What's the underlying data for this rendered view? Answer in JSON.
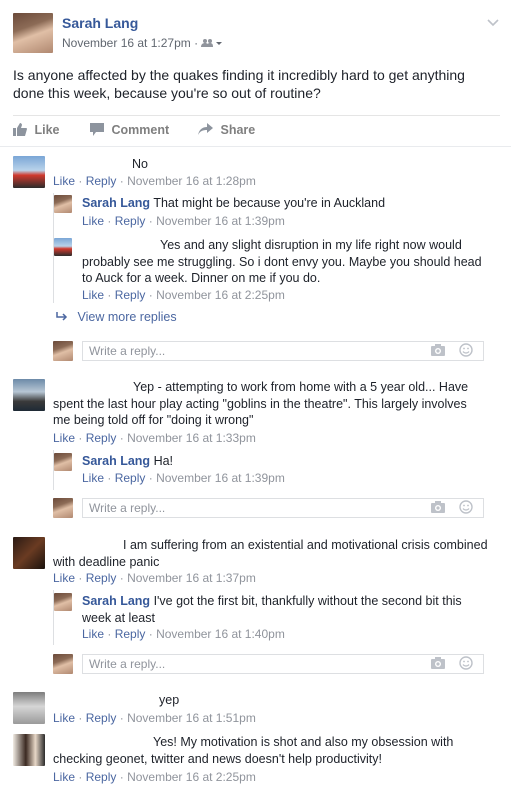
{
  "post": {
    "author": "Sarah Lang",
    "time": "November 16 at 1:27pm",
    "sep": "·",
    "text": "Is anyone affected by the quakes finding it incredibly hard to get anything done this week, because you're so out of routine?",
    "actions": {
      "like": "Like",
      "comment": "Comment",
      "share": "Share"
    }
  },
  "labels": {
    "like": "Like",
    "reply": "Reply",
    "dot": "·",
    "reply_placeholder": "Write a reply...",
    "view_more": "View more replies"
  },
  "comments": [
    {
      "text": "No",
      "time": "November 16 at 1:28pm"
    },
    {
      "text": "Yep - attempting to work from home with a 5 year old... Have spent the last hour play acting \"goblins in the theatre\". This largely involves me being told off for \"doing it wrong\"",
      "time": "November 16 at 1:33pm"
    },
    {
      "text": "I am suffering from an existential and motivational crisis combined with deadline panic",
      "time": "November 16 at 1:37pm"
    },
    {
      "text": "yep",
      "time": "November 16 at 1:51pm"
    },
    {
      "text": "Yes! My motivation is shot and also my obsession with checking geonet, twitter and news doesn't help productivity!",
      "time": "November 16 at 2:25pm"
    }
  ],
  "replies": [
    {
      "author": "Sarah Lang",
      "text": "That might be because you're in Auckland",
      "time": "November 16 at 1:39pm"
    },
    {
      "author": "",
      "text": "Yes and any slight disruption in my life right now would probably see me struggling. So i dont envy you. Maybe you should head to Auck for a week. Dinner on me if you do.",
      "time": "November 16 at 2:25pm"
    },
    {
      "author": "Sarah Lang",
      "text": "Ha!",
      "time": "November 16 at 1:39pm"
    },
    {
      "author": "Sarah Lang",
      "text": "I've got the first bit, thankfully without the second bit this week at least",
      "time": "November 16 at 1:40pm"
    }
  ]
}
